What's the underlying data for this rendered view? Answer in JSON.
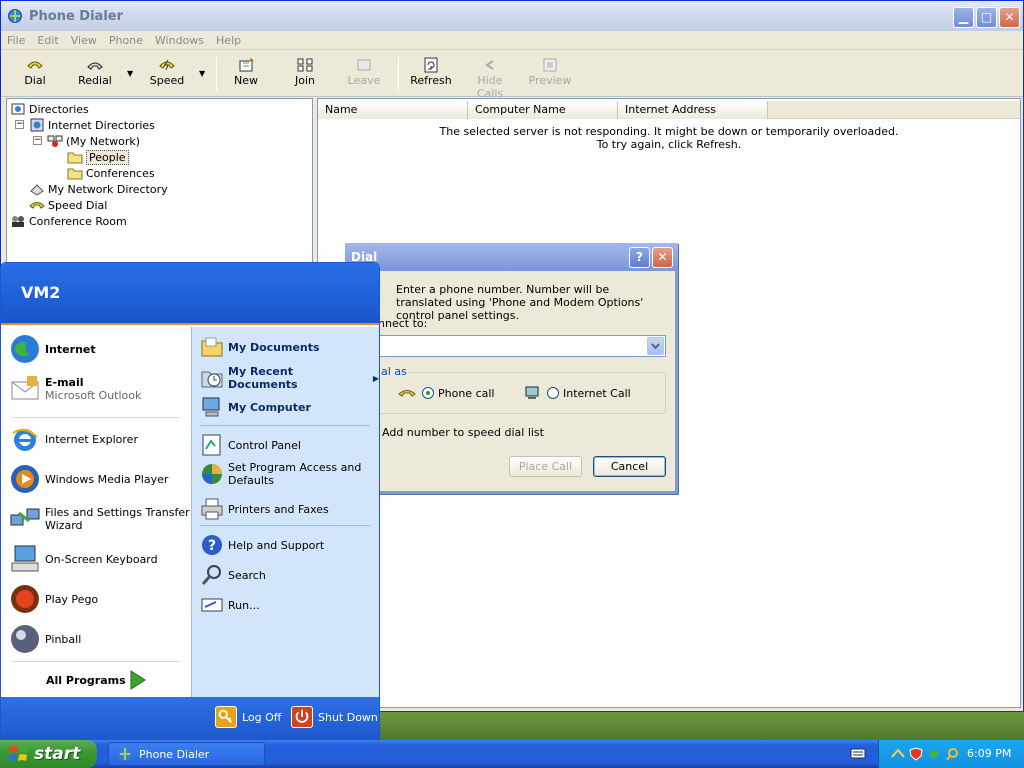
{
  "window": {
    "title": "Phone Dialer",
    "menu": [
      "File",
      "Edit",
      "View",
      "Phone",
      "Windows",
      "Help"
    ]
  },
  "toolbar": {
    "dial": "Dial",
    "redial": "Redial",
    "speed": "Speed",
    "new": "New",
    "join": "Join",
    "leave": "Leave",
    "refresh": "Refresh",
    "hide_calls": "Hide Calls",
    "preview": "Preview"
  },
  "tree": {
    "directories": "Directories",
    "internet_directories": "Internet Directories",
    "my_network": "(My Network)",
    "people": "People",
    "conferences": "Conferences",
    "my_network_directory": "My Network Directory",
    "speed_dial": "Speed Dial",
    "conference_room": "Conference Room"
  },
  "list": {
    "columns": [
      "Name",
      "Computer Name",
      "Internet Address"
    ],
    "message_line1": "The selected server is not responding. It might be down or temporarily overloaded.",
    "message_line2": "To try again, click Refresh."
  },
  "dial_dialog": {
    "title": "Dial",
    "instructions": "Enter a phone number.  Number will be translated using 'Phone and Modem Options' control panel settings.",
    "connect_label": "nnect to:",
    "connect_value": "",
    "dial_as_label": "ial as",
    "phone_call": "Phone call",
    "internet_call": "Internet Call",
    "speed_dial_check": "Add number to speed dial list",
    "place_call": "Place Call",
    "cancel": "Cancel"
  },
  "start_menu": {
    "user": "VM2",
    "left": {
      "internet": "Internet",
      "email": "E-mail",
      "email_sub": "Microsoft Outlook",
      "ie": "Internet Explorer",
      "wmp": "Windows Media Player",
      "fast_l1": "Files and Settings Transfer",
      "fast_l2": "Wizard",
      "osk": "On-Screen Keyboard",
      "pego": "Play Pego",
      "pinball": "Pinball",
      "all_programs": "All Programs"
    },
    "right": {
      "my_documents": "My Documents",
      "my_recent_documents": "My Recent Documents",
      "my_computer": "My Computer",
      "control_panel": "Control Panel",
      "spad_l1": "Set Program Access and",
      "spad_l2": "Defaults",
      "printers": "Printers and Faxes",
      "help": "Help and Support",
      "search": "Search",
      "run": "Run..."
    },
    "log_off": "Log Off",
    "shut_down": "Shut Down"
  },
  "taskbar": {
    "start": "start",
    "task_phone_dialer": "Phone Dialer",
    "clock": "6:09 PM"
  },
  "colors": {
    "xp_blue": "#245edb",
    "start_green": "#3c9a35",
    "tray_blue": "#1290e2"
  }
}
